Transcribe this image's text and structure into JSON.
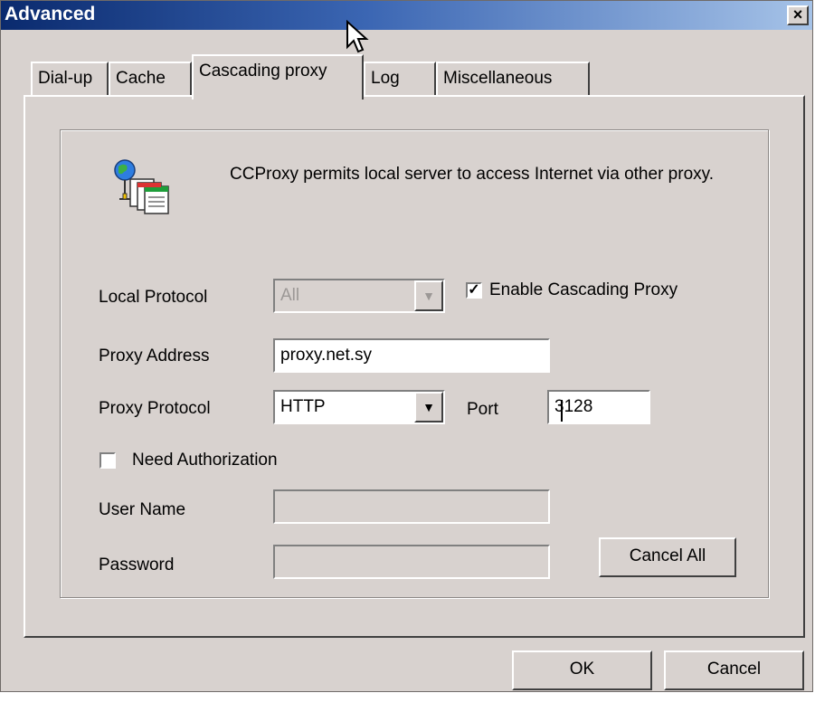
{
  "window": {
    "title": "Advanced",
    "close_glyph": "×"
  },
  "tabs": [
    {
      "label": "Dial-up",
      "active": false
    },
    {
      "label": "Cache",
      "active": false
    },
    {
      "label": "Cascading proxy",
      "active": true
    },
    {
      "label": "Log",
      "active": false
    },
    {
      "label": "Miscellaneous",
      "active": false
    }
  ],
  "content": {
    "description": "CCProxy permits local server to access Internet via other proxy.",
    "icon": "network-proxy-icon",
    "local_protocol": {
      "label": "Local Protocol",
      "value": "All",
      "disabled": true
    },
    "enable_cascading": {
      "label": "Enable Cascading Proxy",
      "checked": true
    },
    "proxy_address": {
      "label": "Proxy Address",
      "value": "proxy.net.sy"
    },
    "proxy_protocol": {
      "label": "Proxy Protocol",
      "value": "HTTP"
    },
    "port": {
      "label": "Port",
      "value": "3128"
    },
    "need_authorization": {
      "label": "Need Authorization",
      "checked": false
    },
    "user_name": {
      "label": "User Name",
      "value": "",
      "disabled": true
    },
    "password": {
      "label": "Password",
      "value": "",
      "disabled": true
    },
    "cancel_all_label": "Cancel All"
  },
  "footer": {
    "ok_label": "OK",
    "cancel_label": "Cancel"
  },
  "colors": {
    "face": "#d8d2cf",
    "title_start": "#0a2a6e",
    "title_end": "#a6c3e8"
  }
}
